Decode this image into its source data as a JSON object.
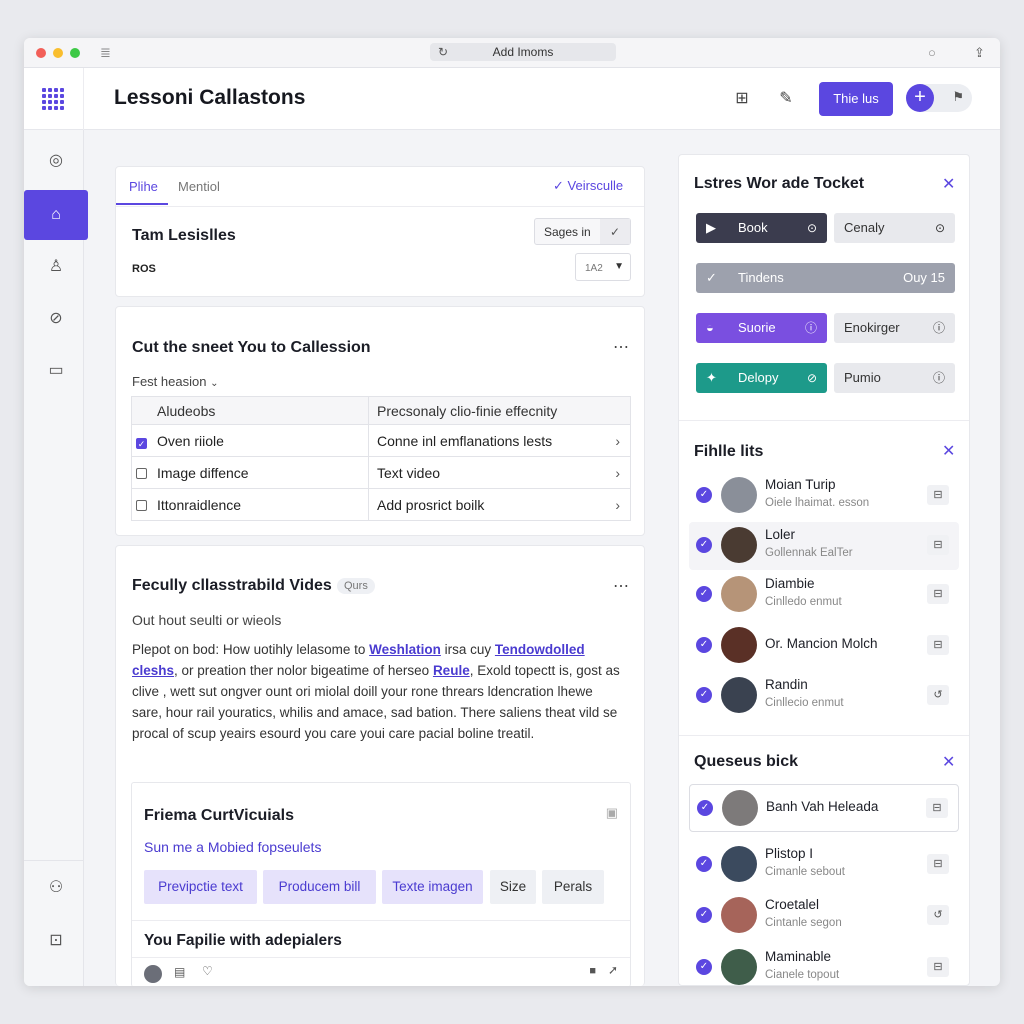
{
  "window": {
    "address": "Add Imoms"
  },
  "header": {
    "title": "Lessoni Callastons",
    "primary_label": "Thie lus"
  },
  "colors": {
    "accent": "#5b47e0",
    "dark_pill": "#3b3c4e",
    "teal_pill": "#1d9a8a",
    "grey_pill": "#9da1ad"
  },
  "sidebar": {
    "items": [
      {
        "icon": "fingerprint-icon"
      },
      {
        "icon": "home-icon",
        "active": true
      },
      {
        "icon": "user-icon"
      },
      {
        "icon": "link-icon"
      },
      {
        "icon": "inbox-icon"
      },
      {
        "icon": "person-settings-icon"
      },
      {
        "icon": "bag-icon"
      }
    ]
  },
  "card1": {
    "tabs": [
      "Plihe",
      "Mentiol"
    ],
    "action": "Veirsculle",
    "heading": "Tam Lesislles",
    "code": "ROS",
    "select_1": "Sages in",
    "select_2": "1A2"
  },
  "card2": {
    "heading": "Cut the sneet You to Callession",
    "filter_label": "Fest heasion",
    "table": {
      "columns": [
        "Aludeobs",
        "Precsonaly clio-finie effecnity"
      ],
      "rows": [
        {
          "checked": true,
          "col1": "Oven riiole",
          "col2": "Conne inl emflanations lests"
        },
        {
          "checked": false,
          "col1": "Image diffence",
          "col2": "Text video"
        },
        {
          "checked": false,
          "col1": "Ittonraidlence",
          "col2": "Add prosrict boilk"
        }
      ]
    }
  },
  "card3": {
    "heading": "Fecully cllasstrabild Vides",
    "badge": "Qurs",
    "subheading": "Out hout seulti or wieols",
    "para": {
      "t1": "Plepot on bod: How uotihly lelasome to ",
      "l1": "Weshlation",
      "t2": " irsa cuy ",
      "l2": "Tendowdolled cleshs",
      "t3": ", or preation ther nolor bigeatime of herseo ",
      "l3": "Reule",
      "t4": ", Exold topectt is, gost as clive , wett sut ongver ount ori miolal doill your rone threars ldencration lhewe sare, hour rail youratics, whilis and amace, sad bation. There saliens theat vild se procal of scup yeairs esourd you care youi care pacial boline treatil."
    },
    "inner": {
      "title": "Friema CurtVicuials",
      "link": "Sun me a Mobied fopseulets",
      "chips": [
        "Previpctie text",
        "Producem bill",
        "Texte imagen",
        "Size",
        "Perals"
      ],
      "footer_title": "You Fapilie with adepialers"
    }
  },
  "panel1": {
    "title": "Lstres Wor ade Tocket",
    "rows": [
      {
        "left": "Book",
        "right": "Cenaly"
      },
      {
        "full_left": "Tindens",
        "full_right": "Ouy 15"
      },
      {
        "left": "Suorie",
        "right": "Enokirger"
      },
      {
        "left": "Delopy",
        "right": "Pumio"
      }
    ]
  },
  "panel2": {
    "title": "Fihlle lits",
    "people": [
      {
        "name": "Moian Turip",
        "sub": "Oiele lhaimat. esson",
        "avatar": "#8a8f99"
      },
      {
        "name": "Loler",
        "sub": "Gollennak EalTer",
        "avatar": "#4a3b32"
      },
      {
        "name": "Diambie",
        "sub": "Cinlledo enmut",
        "avatar": "#b69478"
      },
      {
        "name": "Or. Mancion Molch",
        "sub": "",
        "avatar": "#5a3026"
      },
      {
        "name": "Randin",
        "sub": "Cinllecio enmut",
        "avatar": "#3a4250"
      }
    ]
  },
  "panel3": {
    "title": "Queseus bick",
    "people": [
      {
        "name": "Banh Vah Heleada",
        "sub": "",
        "avatar": "#7d7a7a"
      },
      {
        "name": "Plistop I",
        "sub": "Cimanle sebout",
        "avatar": "#3b4a5e"
      },
      {
        "name": "Croetalel",
        "sub": "Cintanle segon",
        "avatar": "#a6645a"
      },
      {
        "name": "Maminable",
        "sub": "Cianele topout",
        "avatar": "#3f5d4a"
      }
    ]
  }
}
